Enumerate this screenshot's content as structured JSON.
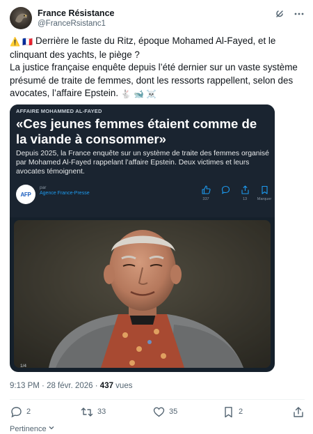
{
  "author": {
    "name": "France Résistance",
    "handle": "@FranceRsistanc1",
    "avatar_icon": "eagle-avatar"
  },
  "header_icons": [
    "grok-icon",
    "more-icon"
  ],
  "tweet": {
    "line1_prefix": "⚠️ 🇫🇷",
    "line1": "Derrière le faste du Ritz, époque Mohamed Al-Fayed, et le clinquant des yachts, le piège ?",
    "line2": "La justice française enquête depuis l’été dernier sur un vaste système présumé de traite de femmes, dont les ressorts rappellent, selon des avocates, l’affaire Epstein.",
    "line2_suffix": "🐇 🐋 ☠️"
  },
  "card": {
    "eyebrow": "AFFAIRE MOHAMMED AL-FAYED",
    "headline": "«Ces jeunes femmes étaient comme de la viande à consommer»",
    "description": "Depuis 2025, la France enquête sur un système de traite des femmes organisé par Mohamed Al-Fayed rappelant l’affaire Epstein. Deux victimes et leurs avocates témoignent.",
    "source_prefix": "par",
    "source_name": "Agence France-Presse",
    "logo_text": "AFP",
    "actions": {
      "like_count": "337",
      "comment_count": "",
      "share_count": "13",
      "bookmark_label": "Marquer"
    },
    "slide_indicator": "1/4"
  },
  "meta": {
    "time": "9:13 PM",
    "sep1": " · ",
    "date": "28 févr. 2026",
    "sep2": " · ",
    "views_count": "437",
    "views_label": " vues"
  },
  "actions": {
    "reply_count": "2",
    "retweet_count": "33",
    "like_count": "35",
    "bookmark_count": "2"
  },
  "footer": {
    "pertinence_label": "Pertinence"
  },
  "colors": {
    "accent": "#1d9bf0",
    "text_secondary": "#536471",
    "card_bg": "#15202b"
  }
}
